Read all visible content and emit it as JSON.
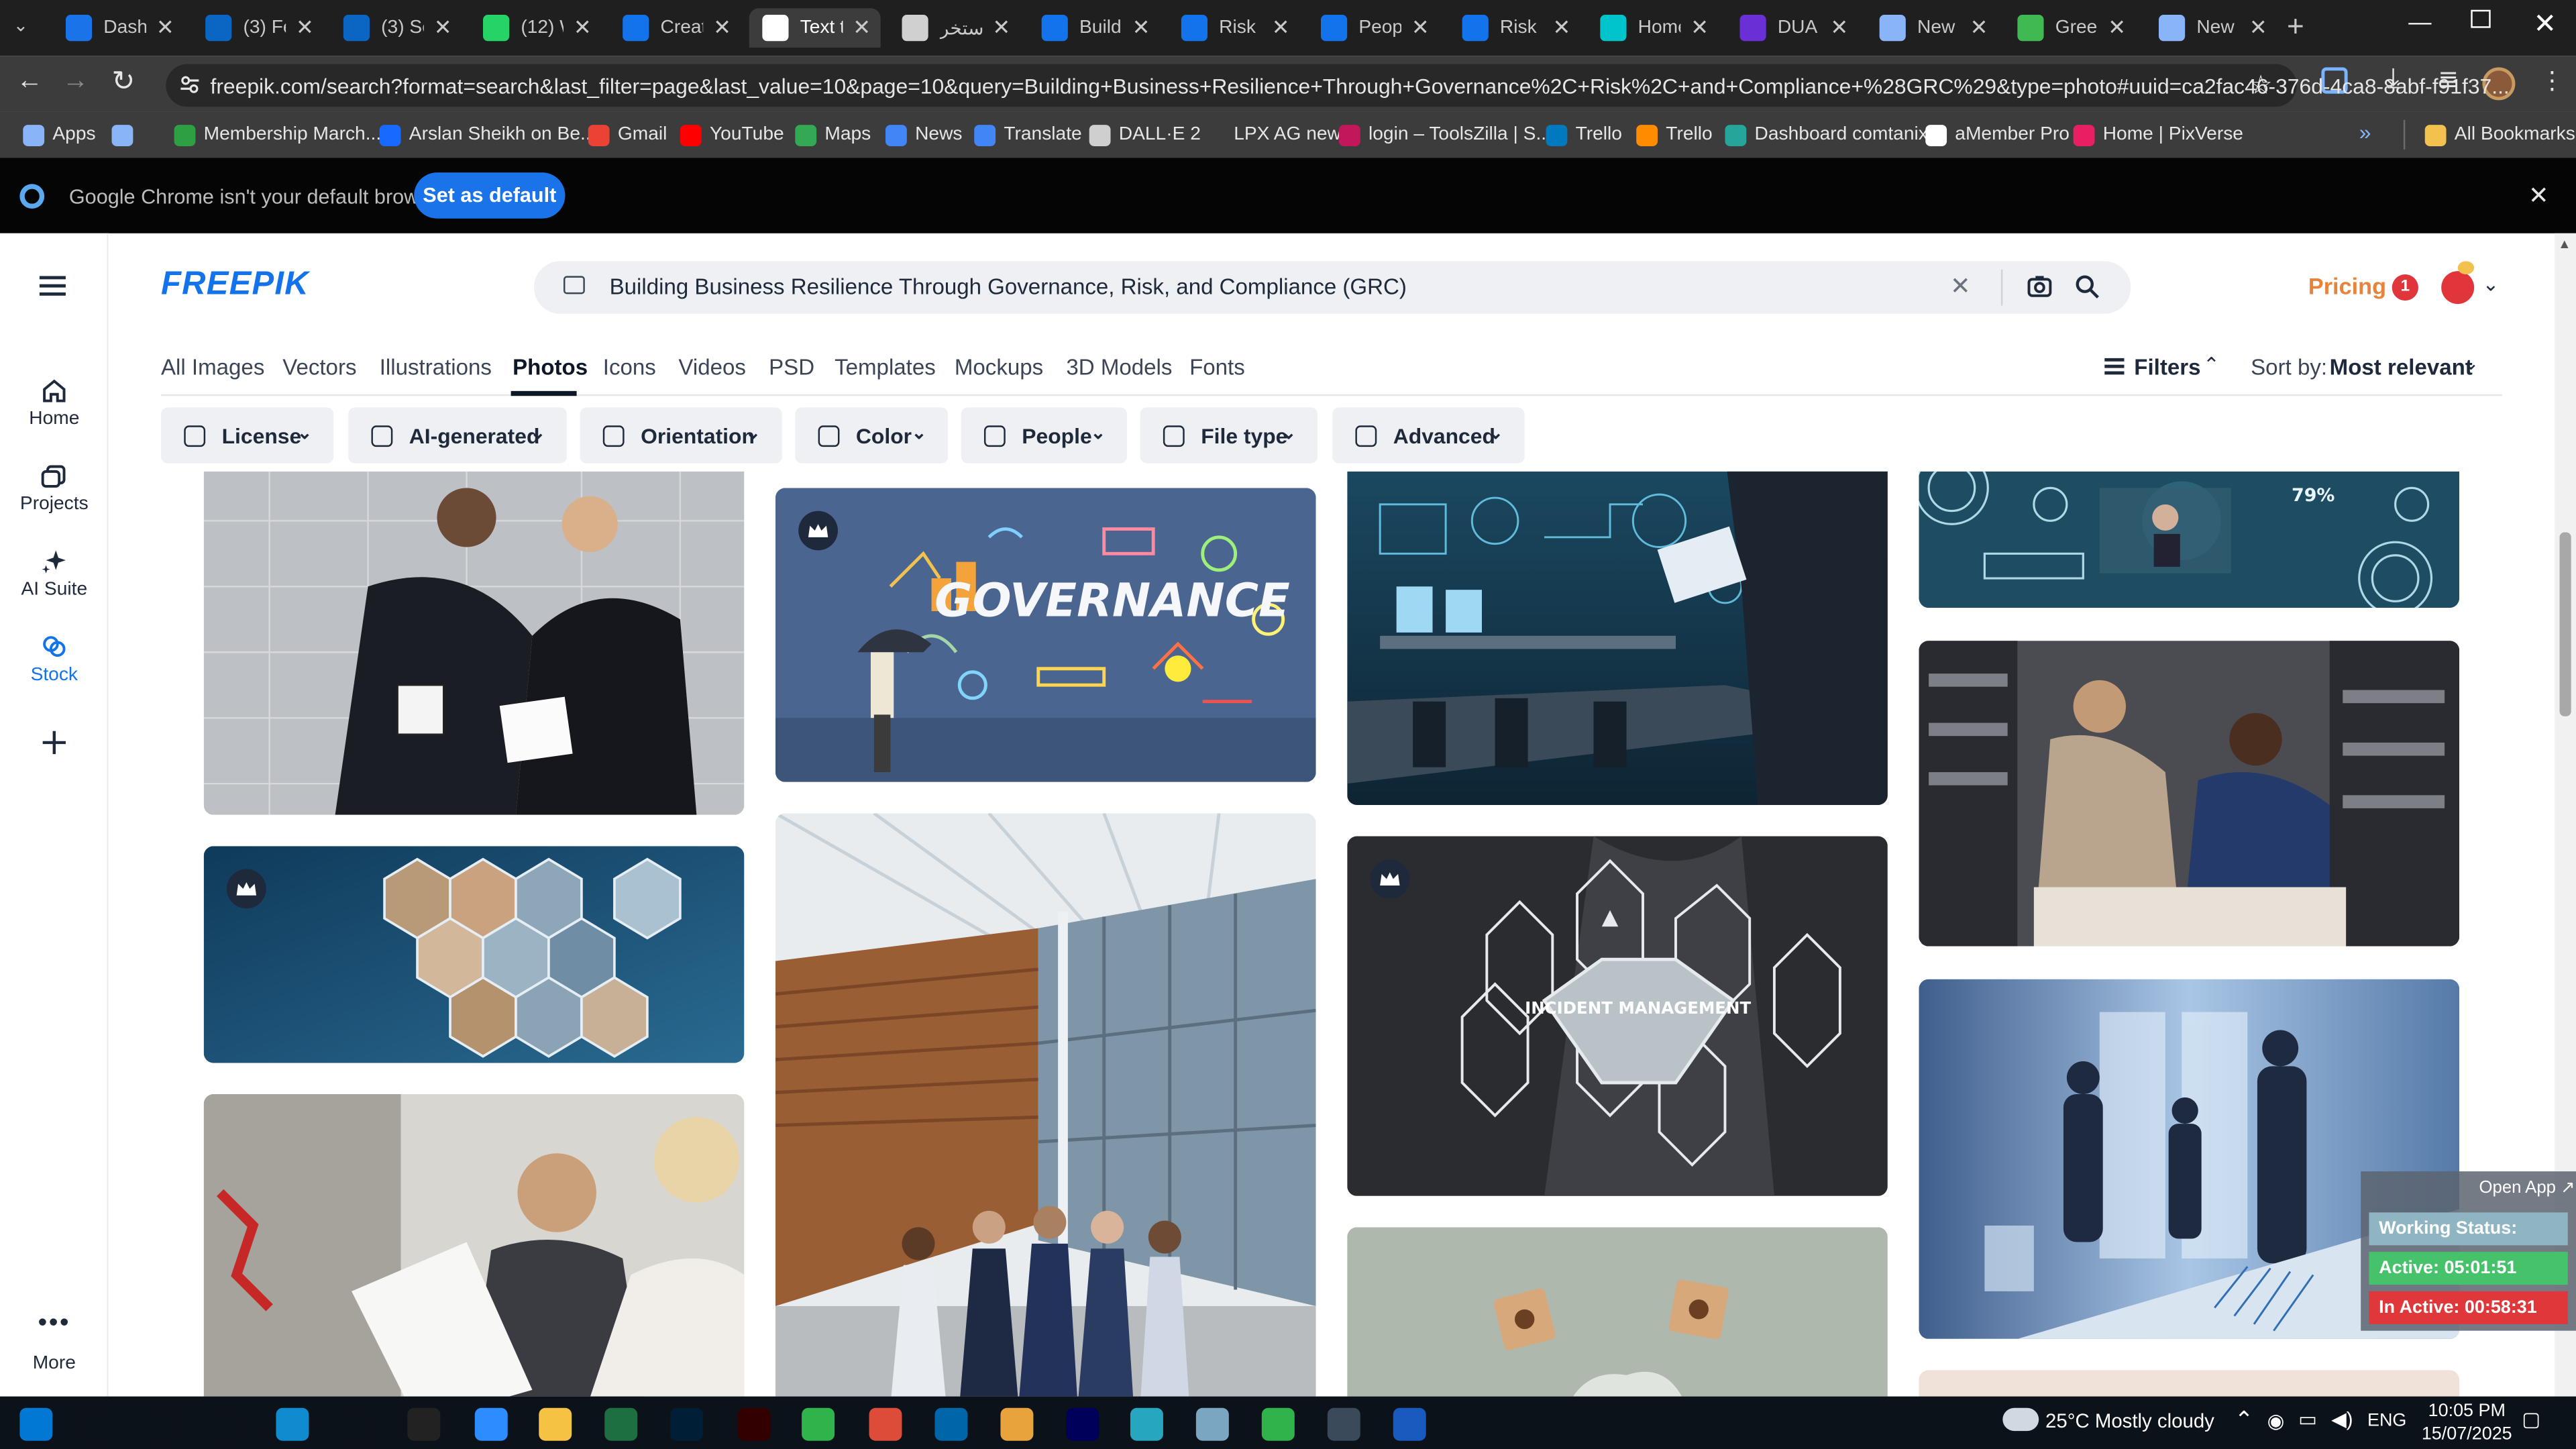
{
  "browser": {
    "tabs": [
      {
        "title": "Dashb",
        "icon": "chrome-tab-icon",
        "color": "#1a73e8"
      },
      {
        "title": "(3) Fe",
        "icon": "linkedin-icon",
        "color": "#0a66c2"
      },
      {
        "title": "(3) Se",
        "icon": "linkedin-icon",
        "color": "#0a66c2"
      },
      {
        "title": "(12) W",
        "icon": "whatsapp-icon",
        "color": "#25d366"
      },
      {
        "title": "Creat",
        "icon": "freepik-tab-icon",
        "color": "#1273eb"
      },
      {
        "title": "Text t",
        "icon": "text-tab-icon",
        "color": "#ffffff"
      },
      {
        "title": "استخر",
        "icon": "openai-icon",
        "color": "#d0d0d0"
      },
      {
        "title": "Buildi",
        "icon": "freepik-tab-icon",
        "color": "#1273eb"
      },
      {
        "title": "Risk n",
        "icon": "freepik-tab-icon",
        "color": "#1273eb"
      },
      {
        "title": "People",
        "icon": "freepik-tab-icon",
        "color": "#1273eb"
      },
      {
        "title": "Risk n",
        "icon": "freepik-tab-icon",
        "color": "#1273eb"
      },
      {
        "title": "Home",
        "icon": "canva-icon",
        "color": "#00c4cc"
      },
      {
        "title": "DUA",
        "icon": "dua-icon",
        "color": "#6b2fd6"
      },
      {
        "title": "New",
        "icon": "chrome-tab-icon",
        "color": "#8ab4f8"
      },
      {
        "title": "Green",
        "icon": "green-tab-icon",
        "color": "#3fb950"
      },
      {
        "title": "New T",
        "icon": "chrome-tab-icon",
        "color": "#8ab4f8"
      }
    ],
    "active_tab_index": 5,
    "url": "freepik.com/search?format=search&last_filter=page&last_value=10&page=10&query=Building+Business+Resilience+Through+Governance%2C+Risk%2C+and+Compliance+%28GRC%29&type=photo#uuid=ca2fac46-376d-4ca8-8abf-f91f37...",
    "bookmarks": [
      {
        "label": "Apps",
        "color": "#8ab4f8"
      },
      {
        "label": "",
        "color": "#8ab4f8"
      },
      {
        "label": "Membership March...",
        "color": "#2ea043"
      },
      {
        "label": "Arslan Sheikh on Be...",
        "color": "#1769ff"
      },
      {
        "label": "Gmail",
        "color": "#ea4335"
      },
      {
        "label": "YouTube",
        "color": "#ff0000"
      },
      {
        "label": "Maps",
        "color": "#34a853"
      },
      {
        "label": "News",
        "color": "#4285f4"
      },
      {
        "label": "Translate",
        "color": "#4285f4"
      },
      {
        "label": "DALL·E 2",
        "color": "#cfcfcf"
      },
      {
        "label": "LPX AG new",
        "color": "#3c3c3c"
      },
      {
        "label": "login – ToolsZilla | S...",
        "color": "#c2185b"
      },
      {
        "label": "Trello",
        "color": "#0079bf"
      },
      {
        "label": "Trello",
        "color": "#ff8c00"
      },
      {
        "label": "Dashboard comtanix",
        "color": "#26a69a"
      },
      {
        "label": "aMember Pro",
        "color": "#ffffff"
      },
      {
        "label": "Home | PixVerse",
        "color": "#e91e63"
      }
    ],
    "all_bookmarks_label": "All Bookmarks",
    "banner_text": "Google Chrome isn't your default browser",
    "banner_button": "Set as default"
  },
  "sidebar": {
    "items": [
      {
        "label": "Home",
        "icon": "home-icon"
      },
      {
        "label": "Projects",
        "icon": "projects-icon"
      },
      {
        "label": "AI Suite",
        "icon": "ai-suite-icon"
      },
      {
        "label": "Stock",
        "icon": "stock-icon"
      },
      {
        "label": "",
        "icon": "plus-icon"
      }
    ],
    "more_label": "More"
  },
  "header": {
    "logo": "FREEPIK",
    "search_value": "Building Business Resilience Through Governance, Risk, and Compliance (GRC)",
    "pricing_label": "Pricing",
    "notification_count": "1"
  },
  "categories": [
    "All Images",
    "Vectors",
    "Illustrations",
    "Photos",
    "Icons",
    "Videos",
    "PSD",
    "Templates",
    "Mockups",
    "3D Models",
    "Fonts"
  ],
  "active_category": "Photos",
  "filters_label": "Filters",
  "sort": {
    "label": "Sort by:",
    "value": "Most relevant"
  },
  "filter_buttons": [
    "License",
    "AI-generated",
    "Orientation",
    "Color",
    "People",
    "File type",
    "Advanced"
  ],
  "images": [
    {
      "name": "two-businessmen-reviewing-documents",
      "premium": false,
      "color": "#b9bcc0"
    },
    {
      "name": "governance-concept-chalkboard",
      "premium": true,
      "color": "#4f6891",
      "overlay_text": "GOVERNANCE"
    },
    {
      "name": "business-analytics-office",
      "premium": false,
      "color": "#1d3a4f"
    },
    {
      "name": "technology-dashboard",
      "premium": false,
      "color": "#1f4f66",
      "overlay_text": "79%"
    },
    {
      "name": "hexagon-collage",
      "premium": true,
      "color": "#1d4a6a"
    },
    {
      "name": "modern-office-building",
      "premium": false,
      "color": "#8d9aa6"
    },
    {
      "name": "incident-management",
      "premium": true,
      "color": "#2a2c30",
      "overlay_text": "INCIDENT MANAGEMENT"
    },
    {
      "name": "colleagues-in-archive",
      "premium": false,
      "color": "#3e4045"
    },
    {
      "name": "meeting-documents",
      "premium": false,
      "color": "#d4d2cc"
    },
    {
      "name": "wooden-cubes-and-puzzle",
      "premium": false,
      "color": "#aab4a8"
    },
    {
      "name": "silhouettes-by-window",
      "premium": false,
      "color": "#4d6d98"
    }
  ],
  "widget": {
    "open_app": "Open App ↗",
    "status": "Working Status: Active",
    "active": "Active: 05:01:51",
    "inactive": "In Active: 00:58:31"
  },
  "taskbar": {
    "weather": "25°C  Mostly cloudy",
    "language": "ENG",
    "time": "10:05 PM",
    "date": "15/07/2025",
    "apps": [
      {
        "icon": "windows-start-icon",
        "color": "#0078d4"
      },
      {
        "icon": "search-icon",
        "color": "#0c1219"
      },
      {
        "icon": "cortana-icon",
        "color": "#0c1219"
      },
      {
        "icon": "task-view-icon",
        "color": "#0c1219"
      },
      {
        "icon": "edge-icon",
        "color": "#0f8ccf"
      },
      {
        "icon": "pen-icon",
        "color": "#0c1219"
      },
      {
        "icon": "terminal-icon",
        "color": "#222"
      },
      {
        "icon": "zoom-icon",
        "color": "#2d8cff"
      },
      {
        "icon": "file-explorer-icon",
        "color": "#f6c244"
      },
      {
        "icon": "excel-icon",
        "color": "#1d6f42"
      },
      {
        "icon": "photoshop-icon",
        "color": "#001e36"
      },
      {
        "icon": "illustrator-icon",
        "color": "#330000"
      },
      {
        "icon": "green-app-icon",
        "color": "#2fb34a"
      },
      {
        "icon": "chrome-icon",
        "color": "#dd4b39"
      },
      {
        "icon": "vscode-icon",
        "color": "#0065a9"
      },
      {
        "icon": "chrome-icon",
        "color": "#e8a33d"
      },
      {
        "icon": "premiere-icon",
        "color": "#00005b"
      },
      {
        "icon": "app-icon",
        "color": "#27a6c0"
      },
      {
        "icon": "app-icon",
        "color": "#7aa6c2"
      },
      {
        "icon": "green-app-icon",
        "color": "#2fb34a"
      },
      {
        "icon": "calculator-icon",
        "color": "#3a4a5a"
      },
      {
        "icon": "word-icon",
        "color": "#185abd"
      }
    ]
  }
}
